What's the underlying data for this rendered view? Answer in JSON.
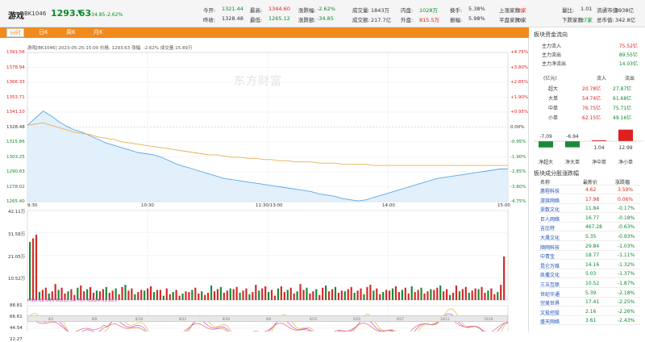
{
  "header": {
    "name": "游戏",
    "code": "BK1046",
    "price": "1293.63",
    "arrow": "▼",
    "change": "-34.85",
    "change_pct": "-2.62%",
    "quotes": [
      {
        "l1": "今开:",
        "v1": "1321.44",
        "c1": "g",
        "l2": "昨收:",
        "v2": "1328.48",
        "c2": "d"
      },
      {
        "l1": "最高:",
        "v1": "1344.60",
        "c1": "r",
        "l2": "最低:",
        "v2": "1265.12",
        "c2": "g"
      },
      {
        "l1": "涨跌幅:",
        "v1": "-2.62%",
        "c1": "g",
        "l2": "涨跌额:",
        "v2": "-34.85",
        "c2": "g"
      },
      {
        "l1": "成交量:",
        "v1": "1843万",
        "c1": "d",
        "l2": "成交额:",
        "v2": "217.7亿",
        "c2": "d"
      },
      {
        "l1": "内盘:",
        "v1": "1028万",
        "c1": "g",
        "l2": "外盘:",
        "v2": "815.5万",
        "c2": "r"
      },
      {
        "l1": "换手:",
        "v1": "5.38%",
        "c1": "d",
        "l2": "振幅:",
        "v2": "5.98%",
        "c2": "d"
      },
      {
        "l1": "上涨家数:",
        "v1": "2家",
        "c1": "r",
        "l2": "平盘家数:",
        "v2": "0家",
        "c2": "d"
      },
      {
        "l1": "量比:",
        "v1": "1.01",
        "c1": "d",
        "l2": "下跌家数:",
        "v2": "27家",
        "c2": "g"
      },
      {
        "l1": "流通市值:",
        "v1": "3938亿",
        "c1": "d",
        "l2": "总市值:",
        "v2": "342.8亿",
        "c2": "d"
      }
    ]
  },
  "tabs": [
    "分时",
    "日K",
    "周K",
    "月K"
  ],
  "chart": {
    "info": "游戏[BK1046]  2023-05-25-15:00  价格: 1293.63  涨幅: -2.62%  成交量:15.89万",
    "watermark": "东方财富",
    "ylabels": [
      "1391.56",
      "1378.94",
      "1366.33",
      "1353.71",
      "1341.10",
      "1328.48",
      "1315.86",
      "1303.25",
      "1290.63",
      "1278.02",
      "1265.40"
    ],
    "pct": [
      "+4.75%",
      "+3.80%",
      "+2.85%",
      "+1.90%",
      "+0.95%",
      "0.00%",
      "-0.95%",
      "-1.90%",
      "-2.85%",
      "-3.80%",
      "-4.75%"
    ],
    "times": [
      "9:30",
      "10:30",
      "11:30/13:00",
      "14:00",
      "15:00"
    ],
    "vol_labels": [
      "42.11万",
      "31.58万",
      "21.05万",
      "10.52万"
    ],
    "rsi_title": "RSI6:66.943  RSI12:64.787  RSI24:61.883",
    "rsi_labels": [
      "88.81",
      "66.61",
      "44.54",
      "22.27"
    ],
    "price_series": [
      1330,
      1336,
      1342,
      1338,
      1333,
      1329,
      1326,
      1324,
      1321,
      1318,
      1315,
      1313,
      1311,
      1309,
      1307,
      1306,
      1305,
      1303,
      1300,
      1297,
      1295,
      1293,
      1291,
      1289,
      1287,
      1285,
      1284,
      1283,
      1282,
      1281,
      1280,
      1279,
      1278,
      1277,
      1276,
      1275,
      1274,
      1272,
      1271,
      1270,
      1268,
      1267,
      1266,
      1267,
      1269,
      1271,
      1273,
      1275,
      1277,
      1279,
      1281,
      1283,
      1285,
      1286,
      1287,
      1288,
      1289,
      1290,
      1291,
      1292,
      1293,
      1293
    ],
    "avg_series": [
      1330,
      1331,
      1332,
      1330,
      1328,
      1326,
      1324,
      1323,
      1322,
      1320,
      1319,
      1318,
      1316,
      1315,
      1314,
      1313,
      1312,
      1311,
      1310,
      1309,
      1308,
      1307,
      1306,
      1305,
      1305,
      1304,
      1303,
      1303,
      1302,
      1302,
      1301,
      1301,
      1300,
      1300,
      1299,
      1299,
      1299,
      1298,
      1298,
      1298,
      1297,
      1297,
      1297,
      1297,
      1296,
      1296,
      1296,
      1296,
      1296,
      1296,
      1296,
      1296,
      1296,
      1296,
      1296,
      1296,
      1296,
      1296,
      1296,
      1296,
      1296,
      1296
    ],
    "scroll_labels": [
      "8/2",
      "8/9",
      "8/16",
      "8/23",
      "8/30",
      "9/6",
      "9/13",
      "9/20",
      "9/27",
      "10/11",
      "10/18"
    ]
  },
  "sidebar": {
    "title": "板块资金流向",
    "flows": [
      {
        "label": "主力流入",
        "value": "75.52亿",
        "cls": "r"
      },
      {
        "label": "主力流出",
        "value": "89.55亿",
        "cls": "g"
      },
      {
        "label": "主力净流出",
        "value": "14.03亿",
        "cls": "g"
      }
    ],
    "table_head": [
      "(亿元)",
      "流入",
      "流出"
    ],
    "orders": [
      {
        "label": "超大",
        "in": "20.78亿",
        "out": "27.87亿"
      },
      {
        "label": "大单",
        "in": "54.74亿",
        "out": "61.68亿"
      },
      {
        "label": "中单",
        "in": "76.75亿",
        "out": "75.71亿"
      },
      {
        "label": "小单",
        "in": "62.15亿",
        "out": "49.16亿"
      }
    ],
    "net_bars": [
      {
        "label": "净超大",
        "value": "-7.09",
        "num": -7.09
      },
      {
        "label": "净大单",
        "value": "-6.94",
        "num": -6.94
      },
      {
        "label": "净中单",
        "value": "1.04",
        "num": 1.04
      },
      {
        "label": "净小单",
        "value": "12.99",
        "num": 12.99
      }
    ],
    "stocks_title": "板块成分股涨跌幅",
    "stocks_head": [
      "名称",
      "最新价",
      "涨跌幅"
    ],
    "stocks": [
      {
        "name": "惠程科技",
        "price": "4.62",
        "pct": "3.59%",
        "cls": "r"
      },
      {
        "name": "游族网络",
        "price": "17.98",
        "pct": "0.06%",
        "cls": "r"
      },
      {
        "name": "浙数文化",
        "price": "11.84",
        "pct": "-0.17%",
        "cls": "g"
      },
      {
        "name": "巨人网络",
        "price": "16.77",
        "pct": "-0.18%",
        "cls": "g"
      },
      {
        "name": "吉比特",
        "price": "467.28",
        "pct": "-0.63%",
        "cls": "g"
      },
      {
        "name": "大晟文化",
        "price": "5.35",
        "pct": "-0.93%",
        "cls": "g"
      },
      {
        "name": "顺网科技",
        "price": "29.84",
        "pct": "-1.03%",
        "cls": "g"
      },
      {
        "name": "中青宝",
        "price": "18.77",
        "pct": "-1.11%",
        "cls": "g"
      },
      {
        "name": "昆仑万维",
        "price": "14.16",
        "pct": "-1.32%",
        "cls": "g"
      },
      {
        "name": "凯撒文化",
        "price": "5.03",
        "pct": "-1.37%",
        "cls": "g"
      },
      {
        "name": "三五互联",
        "price": "10.52",
        "pct": "-1.87%",
        "cls": "g"
      },
      {
        "name": "世纪华通",
        "price": "5.39",
        "pct": "-2.18%",
        "cls": "g"
      },
      {
        "name": "完美世界",
        "price": "17.41",
        "pct": "-2.25%",
        "cls": "g"
      },
      {
        "name": "文投控股",
        "price": "2.16",
        "pct": "-2.26%",
        "cls": "g"
      },
      {
        "name": "盛天网络",
        "price": "3.61",
        "pct": "-2.43%",
        "cls": "g"
      }
    ]
  },
  "colors": {
    "up": "#e02020",
    "down": "#0a8a2a",
    "accent": "#f08a1c",
    "price_line": "#5aa8e8",
    "avg_line": "#e8b050"
  }
}
